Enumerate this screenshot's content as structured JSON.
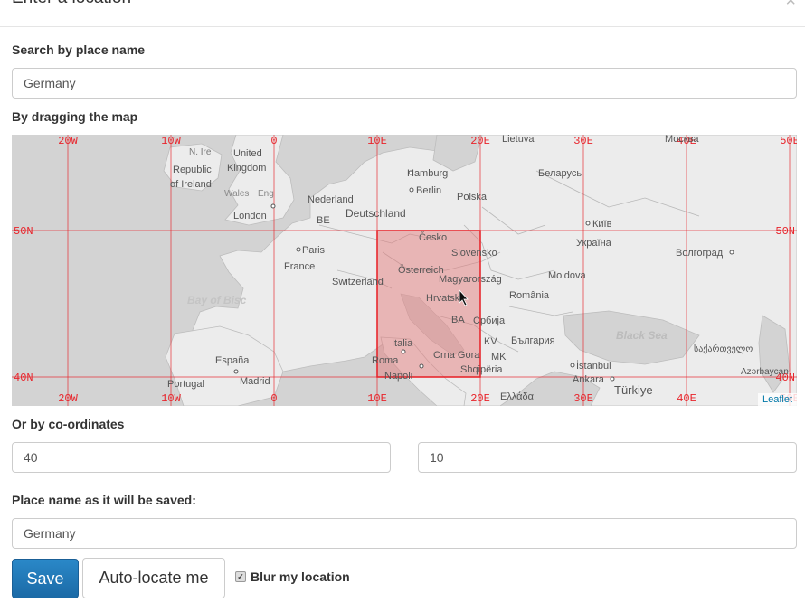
{
  "modal": {
    "title": "Enter a location",
    "close_glyph": "×"
  },
  "search": {
    "label": "Search by place name",
    "value": "Germany"
  },
  "map_section": {
    "label": "By dragging the map",
    "attribution": "Leaflet",
    "grid": {
      "lon_lines": [
        -20,
        -10,
        0,
        10,
        20,
        30,
        40,
        50
      ],
      "lat_lines": [
        40,
        50
      ],
      "lon_labels": [
        "20W",
        "10W",
        "0",
        "10E",
        "20E",
        "30E",
        "40E",
        "50E"
      ],
      "lat_labels": [
        "50N",
        "40N"
      ]
    },
    "selection": {
      "lat_min": 40,
      "lat_max": 50,
      "lon_min": 10,
      "lon_max": 20
    },
    "places": {
      "lietuva": "Lietuva",
      "ire": "N. Ire",
      "united_kingdom_1": "United",
      "united_kingdom_2": "Kingdom",
      "republic_1": "Republic",
      "republic_2": "of Ireland",
      "wales": "Wales",
      "eng": "Eng",
      "london": "London",
      "hamburg": "Hamburg",
      "berlin": "Berlin",
      "polska": "Polska",
      "belarus": "Беларусь",
      "moskva": "Москва",
      "nederland": "Nederland",
      "be": "BE",
      "deutschland": "Deutschland",
      "kyiv": "Київ",
      "cesko": "Česko",
      "slovensko": "Slovensko",
      "ukraina": "Україна",
      "volgograd": "Волгоград",
      "paris": "Paris",
      "france": "France",
      "osterreich": "Österreich",
      "magyarorszag": "Magyarország",
      "moldova": "Moldova",
      "switzerland": "Switzerland",
      "hrvatska": "Hrvatska",
      "romania": "România",
      "bay_of_biscay": "Bay of Bisc",
      "ba": "BA",
      "srbija": "Србија",
      "black_sea": "Black Sea",
      "italia": "Italia",
      "bulgaria": "България",
      "georgia": "საქართველო",
      "espana": "España",
      "roma": "Roma",
      "crna_gora": "Crna Gora",
      "mk": "MK",
      "kv": "KV",
      "istanbul": "İstanbul",
      "shqiperia": "Shqipëria",
      "napoli": "Napoli",
      "portugal": "Portugal",
      "madrid": "Madrid",
      "ankara": "Ankara",
      "turkiye": "Türkiye",
      "azerbaycan": "Azərbaycan",
      "ellada": "Ελλάδα"
    }
  },
  "coordinates": {
    "label": "Or by co-ordinates",
    "latitude": "40",
    "longitude": "10"
  },
  "saved_name": {
    "label": "Place name as it will be saved:",
    "value": "Germany"
  },
  "actions": {
    "save_label": "Save",
    "autolocate_label": "Auto-locate me",
    "blur_label": "Blur my location",
    "blur_checked": true,
    "check_glyph": "✓"
  },
  "colors": {
    "grid_red": "#e8242b",
    "selection_fill": "#e57373",
    "save_blue": "#1f76b5",
    "land": "#ececec",
    "sea": "#d3d3d3"
  }
}
